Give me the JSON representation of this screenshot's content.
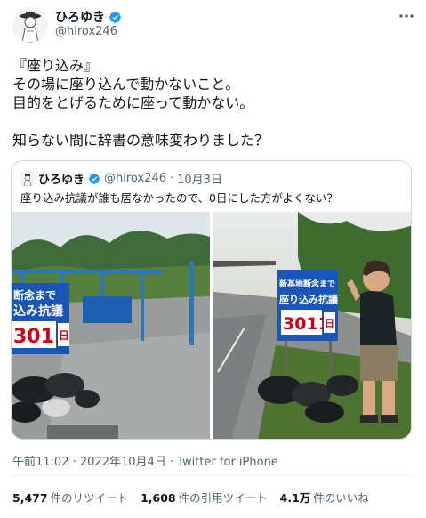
{
  "author": {
    "name": "ひろゆき",
    "handle": "@hirox246"
  },
  "tweet": {
    "lines": [
      "『座り込み』",
      "その場に座り込んで動かないこと。",
      "目的をとげるために座って動かない。",
      "",
      "知らない間に辞書の意味変わりました？"
    ]
  },
  "quote": {
    "name": "ひろゆき",
    "handle": "@hirox246",
    "separator": "·",
    "date": "10月3日",
    "text": "座り込み抗議が誰も居なかったので、0日にした方がよくない？",
    "photo1": {
      "sign_lines": [
        "断念まで",
        "込み抗議"
      ],
      "sign_number": "3011",
      "sign_unit": "日"
    },
    "photo2": {
      "sign_lines": [
        "新基地断念まで",
        "座り込み抗議"
      ],
      "sign_number": "3011",
      "sign_unit": "日"
    }
  },
  "meta": {
    "time": "午前11:02",
    "separator1": "·",
    "date": "2022年10月4日",
    "separator2": "·",
    "source": "Twitter for iPhone"
  },
  "stats": [
    {
      "count": "5,477",
      "label": "件のリツイート"
    },
    {
      "count": "1,608",
      "label": "件の引用ツイート"
    },
    {
      "count": "4.1万",
      "label": "件のいいね"
    }
  ],
  "colors": {
    "verified": "#1d9bf0",
    "secondary_text": "#536471",
    "border": "#cfd9de",
    "sign_bg": "#1a55b8",
    "sign_number": "#d0021b"
  },
  "icons": {
    "verified": "verified-badge-icon",
    "more": "more-horizontal-icon"
  }
}
